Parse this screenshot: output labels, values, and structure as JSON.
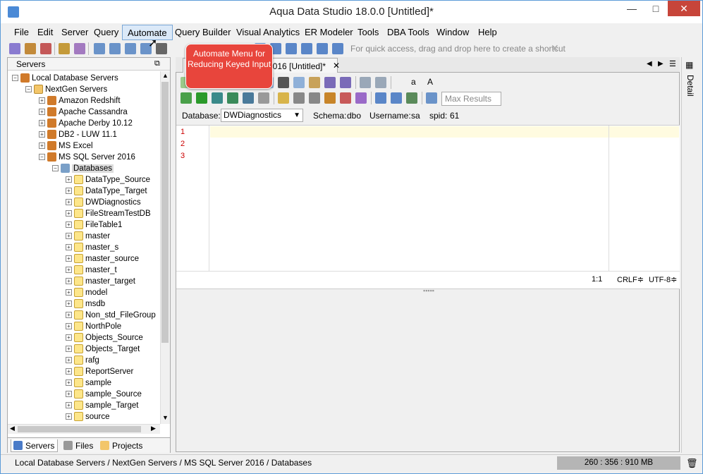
{
  "window": {
    "title": "Aqua Data Studio 18.0.0 [Untitled]*",
    "minimize": "—",
    "maximize": "□",
    "close": "✕"
  },
  "menu": [
    "File",
    "Edit",
    "Server",
    "Query",
    "Automate",
    "Query Builder",
    "Visual Analytics",
    "ER Modeler",
    "Tools",
    "DBA Tools",
    "Window",
    "Help"
  ],
  "toolbar": {
    "shortcut_hint": "For quick access, drag and drop here to create a shortcut",
    "shortcut_close": "✕"
  },
  "callout": {
    "text": "Automate Menu for Reducing Keyed Input"
  },
  "left_panel": {
    "title": "Servers",
    "tree": [
      {
        "label": "Local Database Servers",
        "level": 0,
        "icon": "servers-icon"
      },
      {
        "label": "NextGen Servers",
        "level": 1,
        "icon": "folder-icon"
      },
      {
        "label": "Amazon Redshift",
        "level": 2,
        "icon": "server-icon"
      },
      {
        "label": "Apache Cassandra",
        "level": 2,
        "icon": "server-icon"
      },
      {
        "label": "Apache Derby 10.12",
        "level": 2,
        "icon": "server-icon"
      },
      {
        "label": "DB2 - LUW 11.1",
        "level": 2,
        "icon": "server-icon"
      },
      {
        "label": "MS Excel",
        "level": 2,
        "icon": "server-icon"
      },
      {
        "label": "MS SQL Server 2016",
        "level": 2,
        "icon": "server-icon"
      },
      {
        "label": "Databases",
        "level": 3,
        "icon": "databases-icon"
      },
      {
        "label": "DataType_Source",
        "level": 4,
        "icon": "database-icon"
      },
      {
        "label": "DataType_Target",
        "level": 4,
        "icon": "database-icon"
      },
      {
        "label": "DWDiagnostics",
        "level": 4,
        "icon": "database-icon"
      },
      {
        "label": "FileStreamTestDB",
        "level": 4,
        "icon": "database-icon"
      },
      {
        "label": "FileTable1",
        "level": 4,
        "icon": "database-icon"
      },
      {
        "label": "master",
        "level": 4,
        "icon": "database-icon"
      },
      {
        "label": "master_s",
        "level": 4,
        "icon": "database-icon"
      },
      {
        "label": "master_source",
        "level": 4,
        "icon": "database-icon"
      },
      {
        "label": "master_t",
        "level": 4,
        "icon": "database-icon"
      },
      {
        "label": "master_target",
        "level": 4,
        "icon": "database-icon"
      },
      {
        "label": "model",
        "level": 4,
        "icon": "database-icon"
      },
      {
        "label": "msdb",
        "level": 4,
        "icon": "database-icon"
      },
      {
        "label": "Non_std_FileGroup",
        "level": 4,
        "icon": "database-icon"
      },
      {
        "label": "NorthPole",
        "level": 4,
        "icon": "database-icon"
      },
      {
        "label": "Objects_Source",
        "level": 4,
        "icon": "database-icon"
      },
      {
        "label": "Objects_Target",
        "level": 4,
        "icon": "database-icon"
      },
      {
        "label": "rafg",
        "level": 4,
        "icon": "database-icon"
      },
      {
        "label": "ReportServer",
        "level": 4,
        "icon": "database-icon"
      },
      {
        "label": "sample",
        "level": 4,
        "icon": "database-icon"
      },
      {
        "label": "sample_Source",
        "level": 4,
        "icon": "database-icon"
      },
      {
        "label": "sample_Target",
        "level": 4,
        "icon": "database-icon"
      },
      {
        "label": "source",
        "level": 4,
        "icon": "database-icon"
      }
    ],
    "tabs": [
      "Servers",
      "Files",
      "Projects"
    ]
  },
  "editor": {
    "tab_label": "2016 [Untitled]*",
    "max_results_placeholder": "Max Results",
    "database_label": "Database:",
    "database_value": "DWDiagnostics",
    "schema_label": "Schema:",
    "schema_value": "dbo",
    "username_label": "Username:",
    "username_value": "sa",
    "spid_label": "spid:",
    "spid_value": "61",
    "line_numbers": [
      "1",
      "2",
      "3"
    ],
    "cursor_pos": "1:1",
    "line_ending": "CRLF≑",
    "encoding": "UTF-8≑",
    "font_small": "a",
    "font_large": "A"
  },
  "right_strip": {
    "detail": "Detail"
  },
  "statusbar": {
    "path": "Local Database Servers / NextGen Servers / MS SQL Server 2016 / Databases",
    "memory": "260 : 356 : 910 MB"
  }
}
